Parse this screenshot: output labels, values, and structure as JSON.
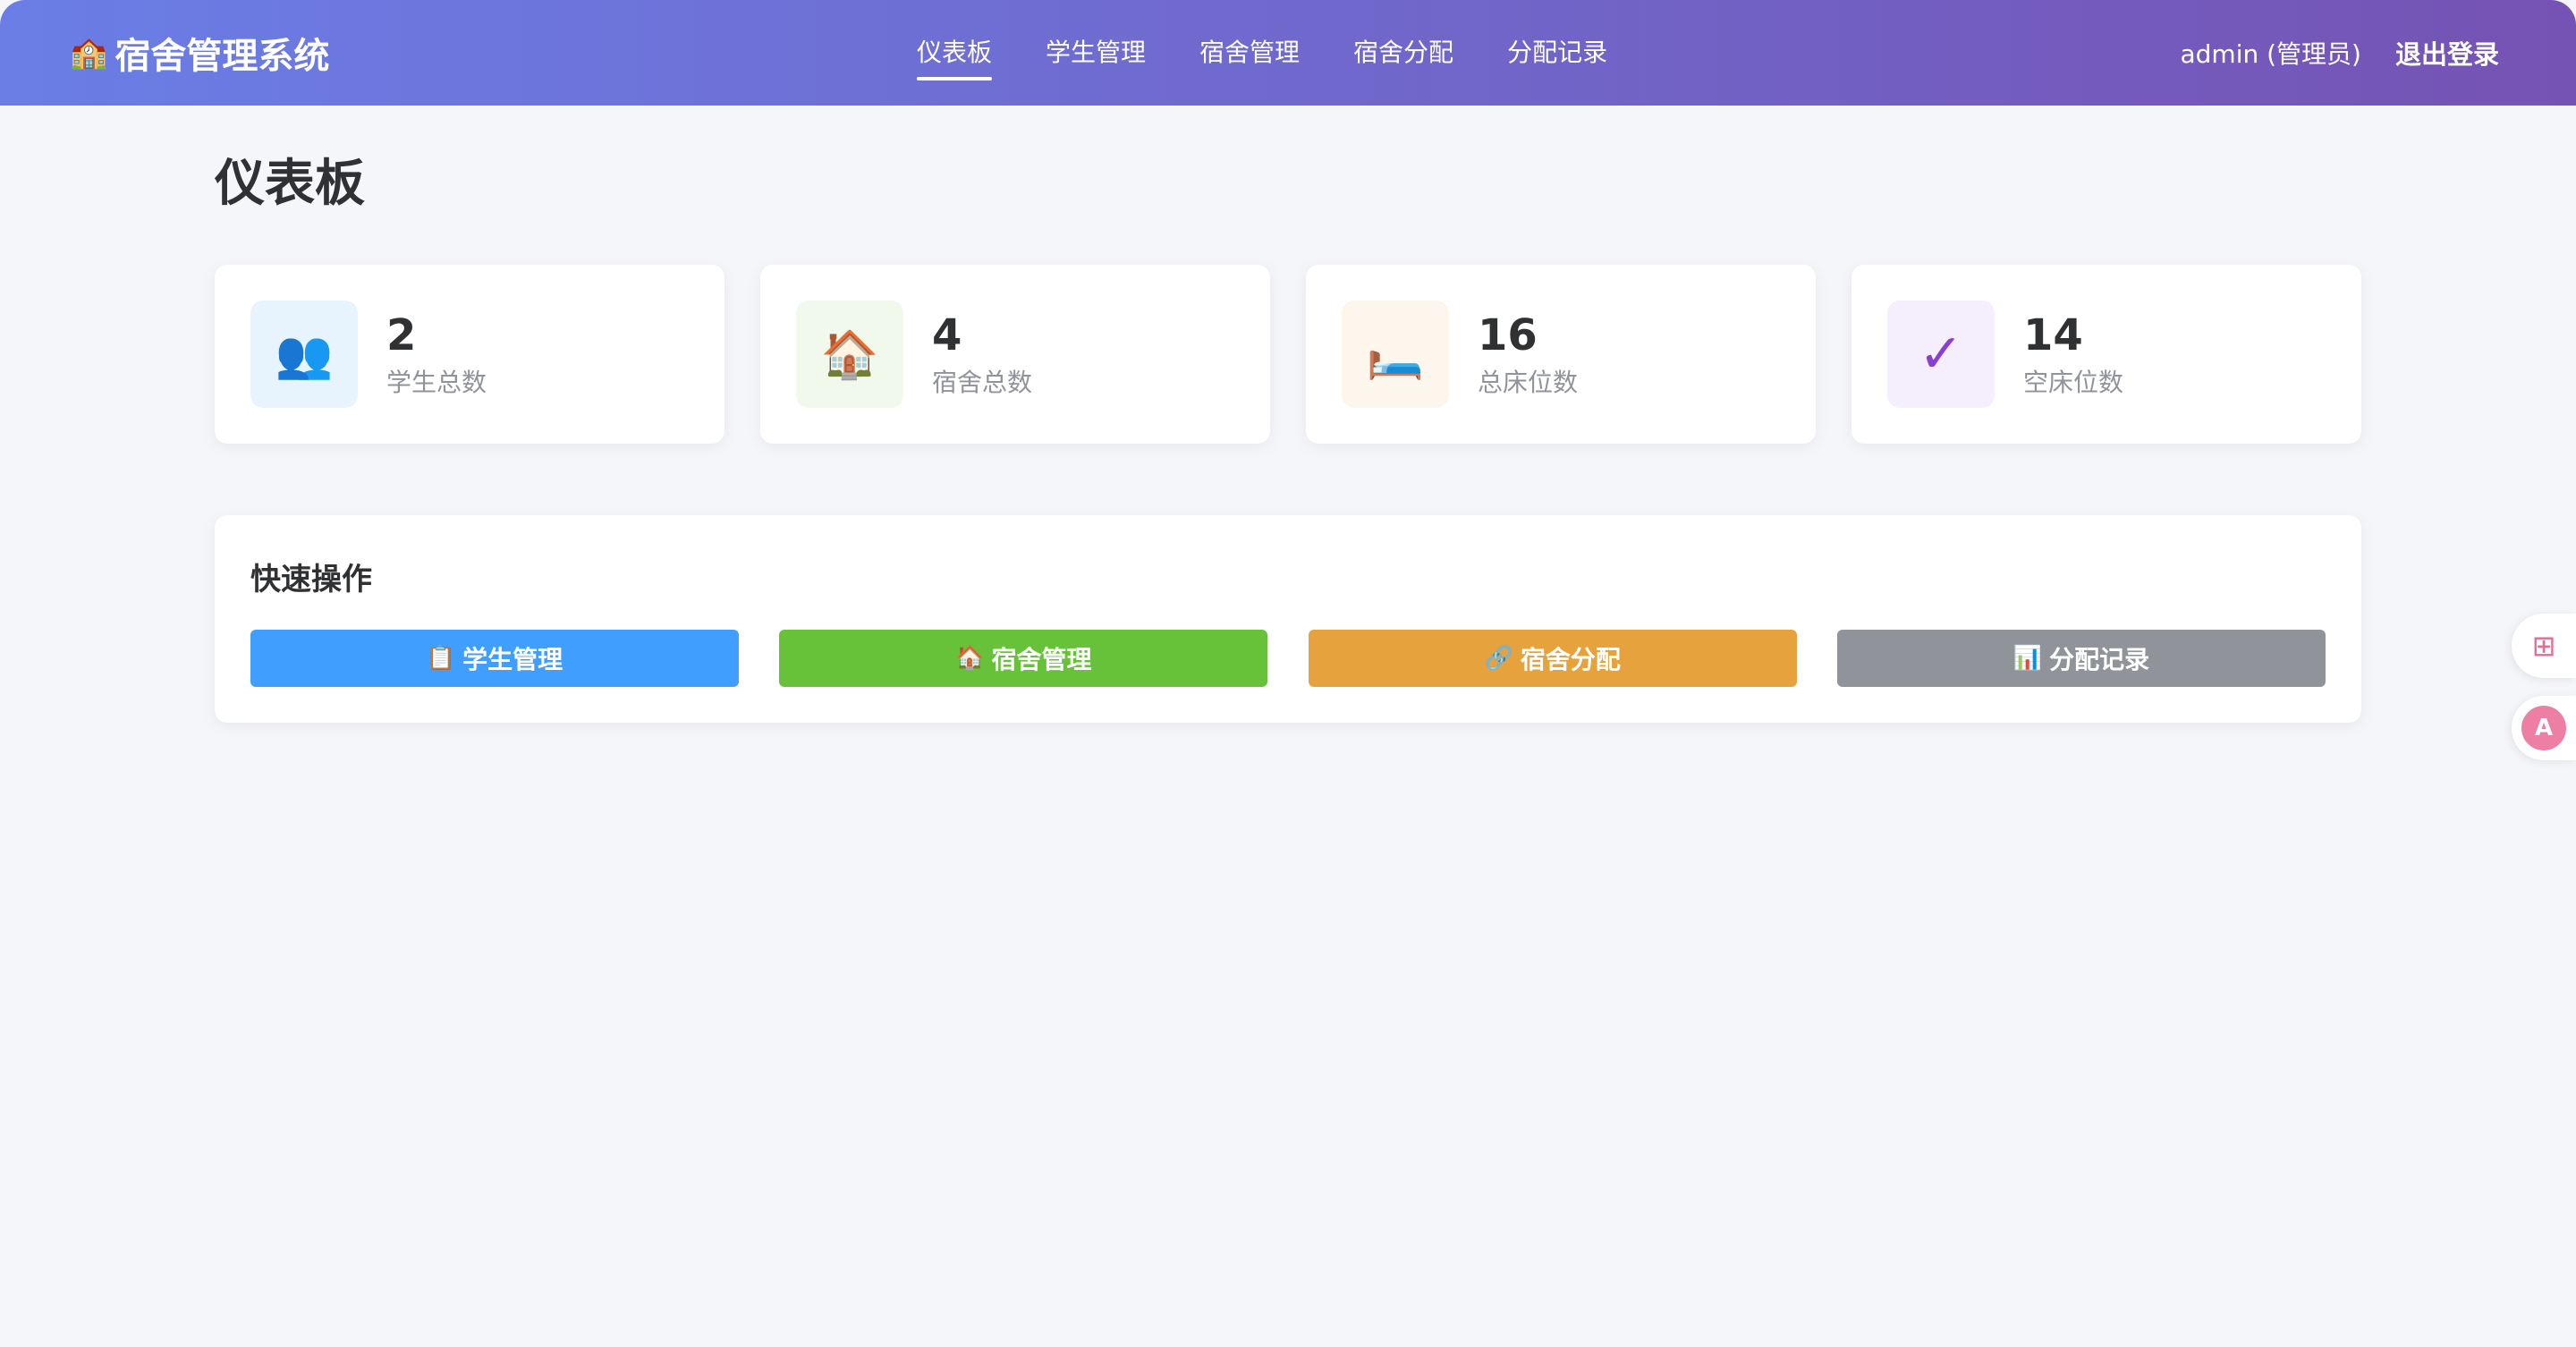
{
  "header": {
    "brand_icon": "🏫",
    "brand_title": "宿舍管理系统",
    "nav": [
      {
        "label": "仪表板",
        "active": true
      },
      {
        "label": "学生管理"
      },
      {
        "label": "宿舍管理"
      },
      {
        "label": "宿舍分配"
      },
      {
        "label": "分配记录"
      }
    ],
    "user": "admin (管理员)",
    "logout": "退出登录",
    "gradient_start": "#6a7ee6",
    "gradient_end": "#7553b4"
  },
  "page_title": "仪表板",
  "stats": [
    {
      "icon": "👥",
      "icon_name": "students-icon",
      "value": "2",
      "label": "学生总数",
      "icon_bg": "#e8f4fd"
    },
    {
      "icon": "🏠",
      "icon_name": "house-icon",
      "value": "4",
      "label": "宿舍总数",
      "icon_bg": "#f0f9eb"
    },
    {
      "icon": "🛏️",
      "icon_name": "bed-icon",
      "value": "16",
      "label": "总床位数",
      "icon_bg": "#fdf6ec"
    },
    {
      "icon": "✓",
      "icon_name": "check-icon",
      "value": "14",
      "label": "空床位数",
      "icon_bg": "#f5eefc"
    }
  ],
  "quick": {
    "title": "快速操作",
    "actions": [
      {
        "icon": "📋",
        "icon_name": "clipboard-icon",
        "label": "学生管理",
        "color": "#409eff"
      },
      {
        "icon": "🏠",
        "icon_name": "house-icon",
        "label": "宿舍管理",
        "color": "#67c23a"
      },
      {
        "icon": "🔗",
        "icon_name": "link-icon",
        "label": "宿舍分配",
        "color": "#e6a23c"
      },
      {
        "icon": "📊",
        "icon_name": "bar-chart-icon",
        "label": "分配记录",
        "color": "#909399"
      }
    ]
  },
  "widgets": {
    "apps_icon": "⊞",
    "translate_icon": "A"
  }
}
